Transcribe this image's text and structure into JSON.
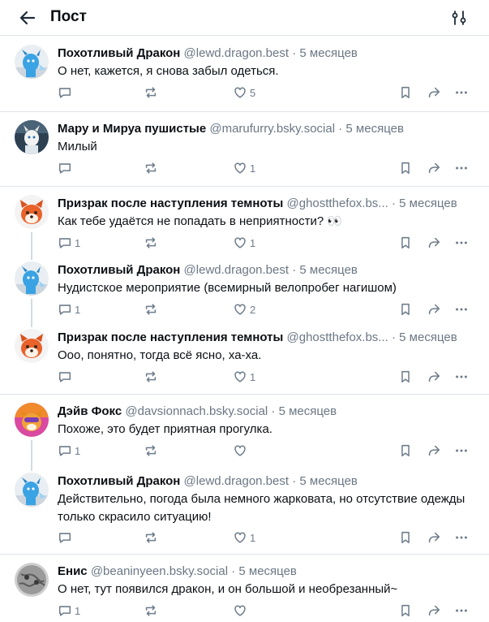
{
  "header": {
    "title": "Пост"
  },
  "colors": {
    "text": "#0b0f14",
    "muted": "#6b7784",
    "divider": "#dfe3e8",
    "thread": "#d4dbe2"
  },
  "icons": {
    "back": "arrow-left-icon",
    "filter": "sliders-icon",
    "reply": "comment-icon",
    "repost": "repost-icon",
    "like": "heart-icon",
    "bookmark": "bookmark-icon",
    "share": "share-icon",
    "more": "ellipsis-icon"
  },
  "posts": [
    {
      "name": "Похотливый Дракон",
      "handle": "@lewd.dragon.best",
      "sep": " · ",
      "time": "5 месяцев",
      "text": "О нет, кажется, я снова забыл одеться.",
      "replies": "",
      "reposts": "",
      "likes": "5"
    },
    {
      "name": "Мару и Мируа пушистые",
      "handle": "@marufurry.bsky.social",
      "sep": " · ",
      "time": "5 месяцев",
      "text": "Милый",
      "replies": "",
      "reposts": "",
      "likes": "1"
    },
    {
      "name": "Призрак после наступления темноты",
      "handle": "@ghostthefox.bs...",
      "sep": " · ",
      "time": "5 месяцев",
      "text": "Как тебе удаётся не попадать в неприятности? 👀",
      "replies": "1",
      "reposts": "",
      "likes": "1"
    },
    {
      "name": "Похотливый Дракон",
      "handle": "@lewd.dragon.best",
      "sep": " · ",
      "time": "5 месяцев",
      "text": "Нудистское мероприятие (всемирный велопробег нагишом)",
      "replies": "1",
      "reposts": "",
      "likes": "2"
    },
    {
      "name": "Призрак после наступления темноты",
      "handle": "@ghostthefox.bs...",
      "sep": " · ",
      "time": "5 месяцев",
      "text": "Ооо, понятно, тогда всё ясно, ха-ха.",
      "replies": "",
      "reposts": "",
      "likes": "1"
    },
    {
      "name": "Дэйв Фокс",
      "handle": "@davsionnach.bsky.social",
      "sep": " · ",
      "time": "5 месяцев",
      "text": "Похоже, это будет приятная прогулка.",
      "replies": "1",
      "reposts": "",
      "likes": ""
    },
    {
      "name": "Похотливый Дракон",
      "handle": "@lewd.dragon.best",
      "sep": " · ",
      "time": "5 месяцев",
      "text": "Действительно, погода была немного жарковата, но отсутствие одежды только скрасило ситуацию!",
      "replies": "",
      "reposts": "",
      "likes": "1"
    },
    {
      "name": "Енис",
      "handle": "@beaninyeen.bsky.social",
      "sep": " · ",
      "time": "5 месяцев",
      "text": "О нет, тут появился дракон, и он большой и необрезанный~",
      "replies": "1",
      "reposts": "",
      "likes": ""
    }
  ]
}
